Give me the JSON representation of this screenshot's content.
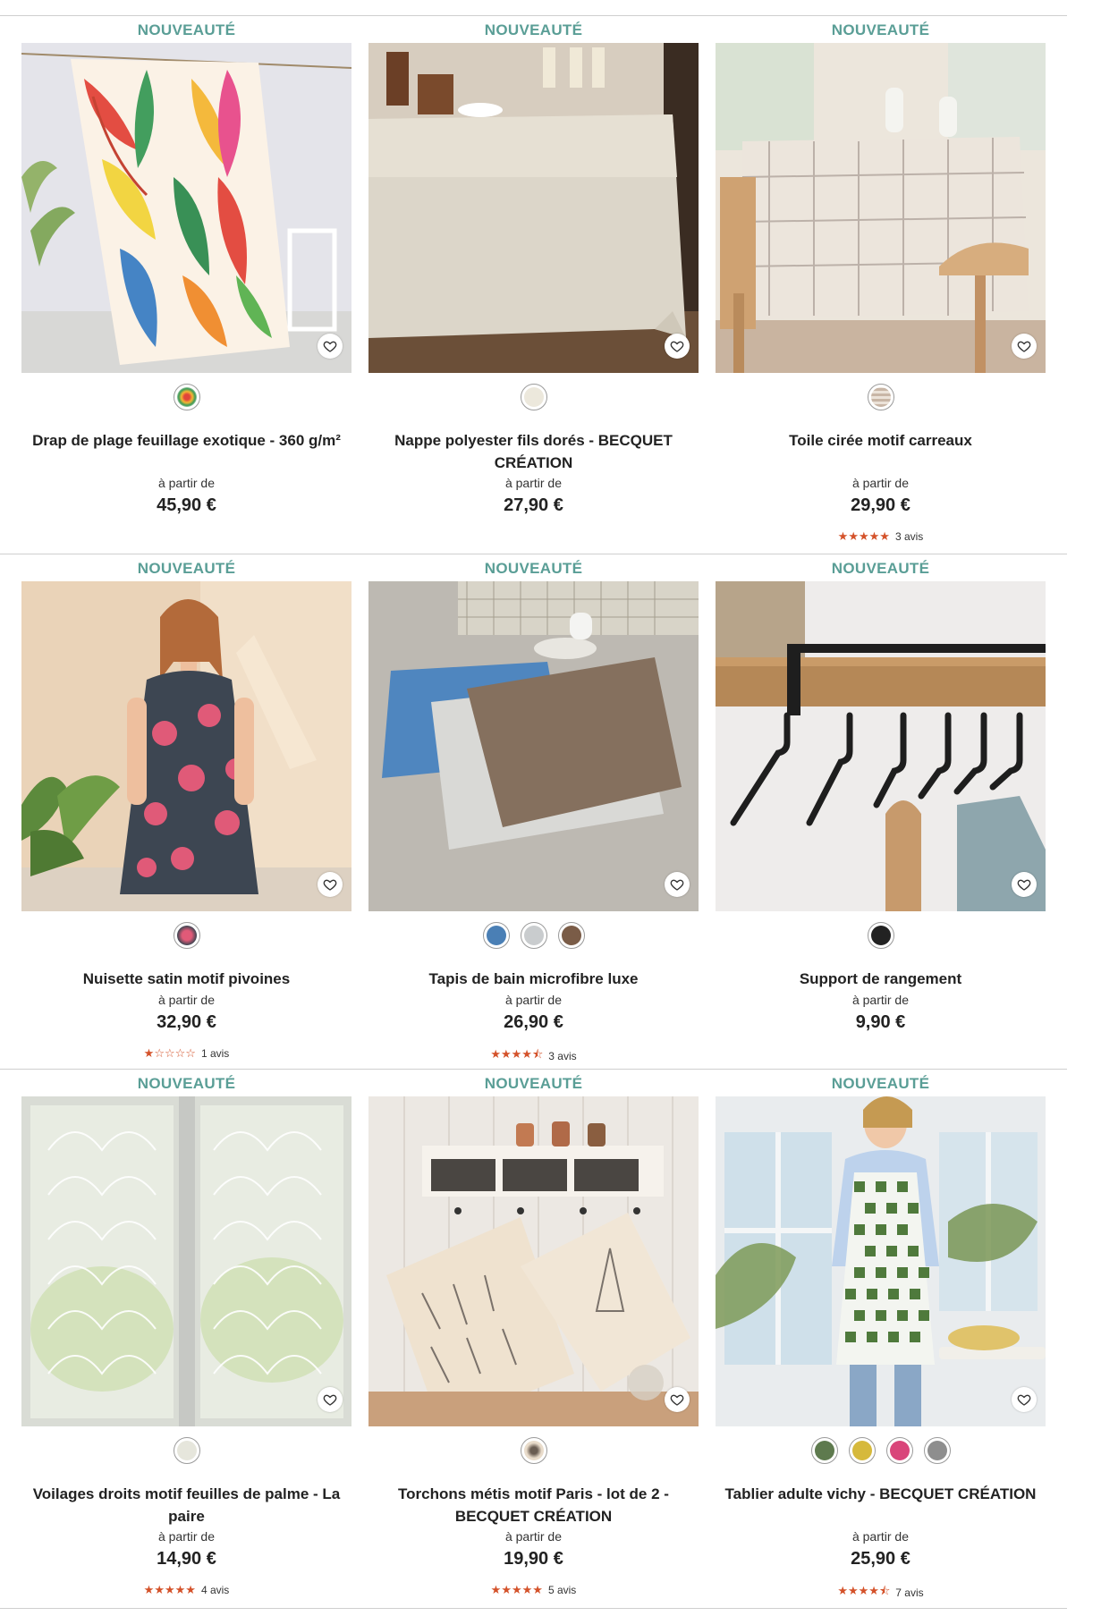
{
  "badge_label": "NOUVEAUTÉ",
  "from_label": "à partir de",
  "colors": {
    "badge": "#5a9e96",
    "star": "#d4522a"
  },
  "products": [
    {
      "name": "Drap de plage feuillage exotique - 360 g/m²",
      "price": "45,90 €",
      "swatches": [
        {
          "color": "#e9a64f",
          "pattern": "floral"
        }
      ],
      "rating": null,
      "reviews": ""
    },
    {
      "name": "Nappe polyester fils dorés - BECQUET CRÉATION",
      "price": "27,90 €",
      "swatches": [
        {
          "color": "#ece8dc"
        }
      ],
      "rating": null,
      "reviews": ""
    },
    {
      "name": "Toile cirée motif carreaux",
      "price": "29,90 €",
      "swatches": [
        {
          "color": "#c8b6a6",
          "pattern": "check"
        }
      ],
      "rating": 5,
      "stars": "★★★★★",
      "reviews": "3 avis"
    },
    {
      "name": "Nuisette satin motif pivoines",
      "price": "32,90 €",
      "swatches": [
        {
          "color": "#c43a55",
          "pattern": "floral"
        }
      ],
      "rating": 1,
      "stars": "★☆☆☆☆",
      "reviews": "1 avis"
    },
    {
      "name": "Tapis de bain microfibre luxe",
      "price": "26,90 €",
      "swatches": [
        {
          "color": "#4a7fb5"
        },
        {
          "color": "#c9ccce"
        },
        {
          "color": "#7a5c47"
        }
      ],
      "rating": 4.5,
      "stars": "★★★★⯪",
      "reviews": "3 avis"
    },
    {
      "name": "Support de rangement",
      "price": "9,90 €",
      "swatches": [
        {
          "color": "#222222"
        }
      ],
      "rating": null,
      "reviews": ""
    },
    {
      "name": "Voilages droits motif feuilles de palme - La paire",
      "price": "14,90 €",
      "swatches": [
        {
          "color": "#e6e6dc"
        }
      ],
      "rating": 5,
      "stars": "★★★★★",
      "reviews": "4 avis"
    },
    {
      "name": "Torchons métis motif Paris - lot de 2 - BECQUET CRÉATION",
      "price": "19,90 €",
      "swatches": [
        {
          "color": "#e9dccb",
          "pattern": "print"
        }
      ],
      "rating": 5,
      "stars": "★★★★★",
      "reviews": "5 avis"
    },
    {
      "name": "Tablier adulte vichy - BECQUET CRÉATION",
      "price": "25,90 €",
      "swatches": [
        {
          "color": "#5e7a4e"
        },
        {
          "color": "#d6b93c"
        },
        {
          "color": "#d9457a"
        },
        {
          "color": "#8e8e8e"
        }
      ],
      "rating": 4.5,
      "stars": "★★★★⯪",
      "reviews": "7 avis"
    }
  ]
}
